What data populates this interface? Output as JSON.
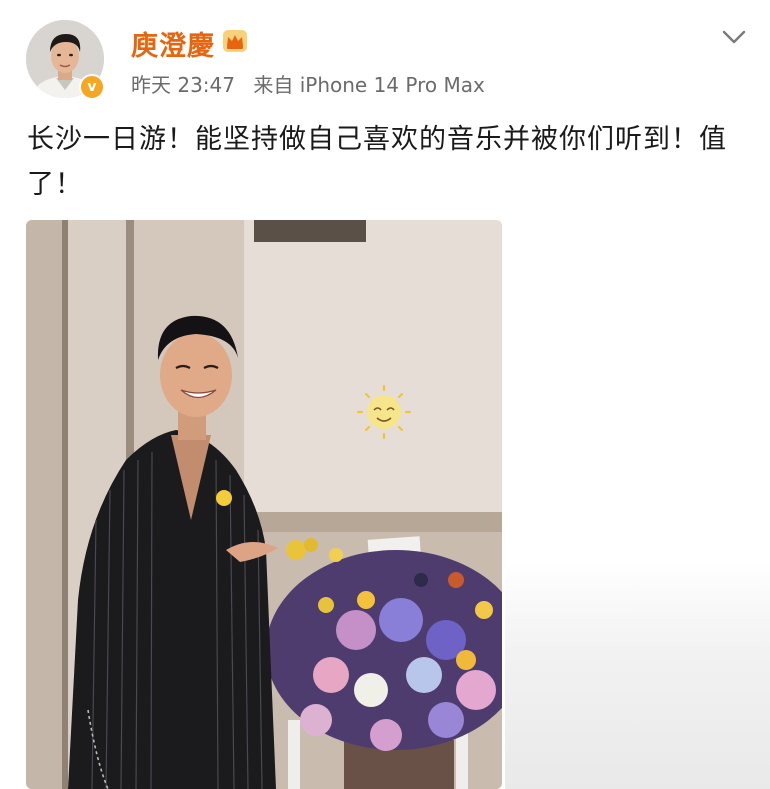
{
  "post": {
    "author": {
      "name": "庾澄慶",
      "avatar_icon": "avatar",
      "verified_badge": "v",
      "crown_icon": "crown-icon",
      "badge_color": "#f5a623",
      "name_color": "#e8650f"
    },
    "meta": {
      "time": "昨天 23:47",
      "source": "来自 iPhone 14 Pro Max"
    },
    "text": "长沙一日游！能坚持做自己喜欢的音乐并被你们听到！值了！",
    "menu_icon": "chevron-down-icon",
    "photo": {
      "icon": "photo",
      "sticker_icon": "sun-emoji-icon"
    }
  }
}
